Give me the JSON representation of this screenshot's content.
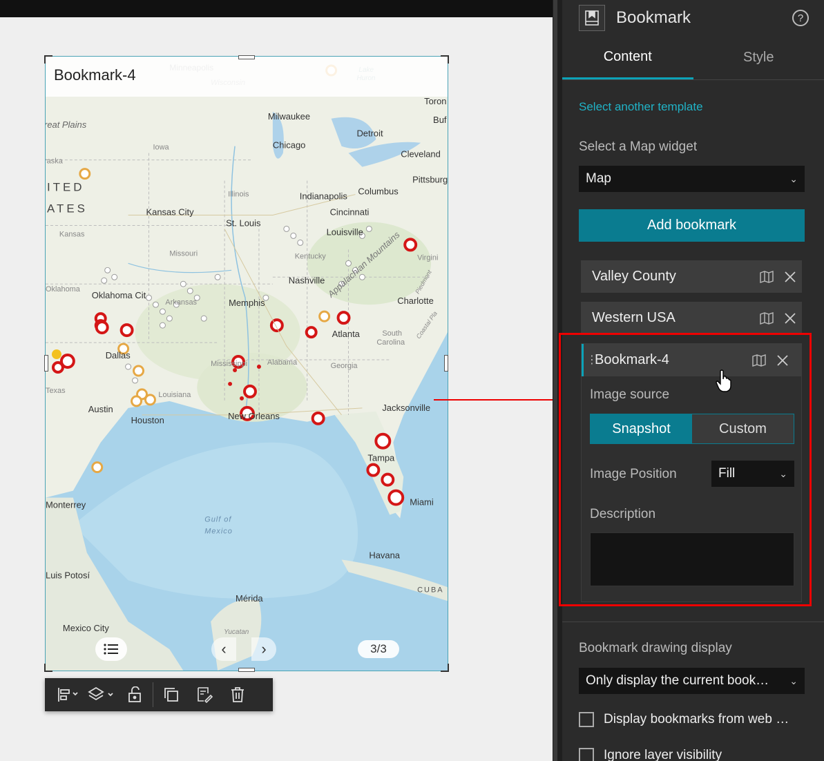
{
  "widget": {
    "title": "Bookmark-4",
    "page_count": "3/3",
    "map_labels": {
      "cities": [
        {
          "name": "Minneapolis"
        },
        {
          "name": "Wisconsin"
        },
        {
          "name": "Lake Huron"
        },
        {
          "name": "Toron"
        },
        {
          "name": "Milwaukee"
        },
        {
          "name": "Buf"
        },
        {
          "name": "reat Plains"
        },
        {
          "name": "Detroit"
        },
        {
          "name": "Iowa"
        },
        {
          "name": "Chicago"
        },
        {
          "name": "Cleveland"
        },
        {
          "name": "raska"
        },
        {
          "name": "Pittsburg"
        },
        {
          "name": "ITED"
        },
        {
          "name": "Columbus"
        },
        {
          "name": "Illinois"
        },
        {
          "name": "Indianapolis"
        },
        {
          "name": "ATES"
        },
        {
          "name": "Kansas City"
        },
        {
          "name": "Cincinnati"
        },
        {
          "name": "St. Louis"
        },
        {
          "name": "Kansas"
        },
        {
          "name": "Louisville"
        },
        {
          "name": "Missouri"
        },
        {
          "name": "Kentucky"
        },
        {
          "name": "Appalachian Mountains"
        },
        {
          "name": "Virgini"
        },
        {
          "name": "Nashville"
        },
        {
          "name": "Oklahoma"
        },
        {
          "name": "Oklahoma City"
        },
        {
          "name": "Arkansas"
        },
        {
          "name": "Piedmont"
        },
        {
          "name": "Memphis"
        },
        {
          "name": "Charlotte"
        },
        {
          "name": "Coastal Pla"
        },
        {
          "name": "Atlanta"
        },
        {
          "name": "South Carolina"
        },
        {
          "name": "Dallas"
        },
        {
          "name": "Mississippi"
        },
        {
          "name": "Alabama"
        },
        {
          "name": "Georgia"
        },
        {
          "name": "Texas"
        },
        {
          "name": "Louisiana"
        },
        {
          "name": "Austin"
        },
        {
          "name": "Houston"
        },
        {
          "name": "New Orleans"
        },
        {
          "name": "Jacksonville"
        },
        {
          "name": "Tampa"
        },
        {
          "name": "Monterrey"
        },
        {
          "name": "Miami"
        },
        {
          "name": "Gulf of"
        },
        {
          "name": "Mexico"
        },
        {
          "name": "Havana"
        },
        {
          "name": "Luis Potosí"
        },
        {
          "name": "CUBA"
        },
        {
          "name": "Mérida"
        },
        {
          "name": "Mexico City"
        },
        {
          "name": "Yucatan"
        }
      ]
    }
  },
  "toolbar": {
    "icons": [
      "align-icon",
      "layers-icon",
      "lock-icon",
      "duplicate-icon",
      "edit-icon",
      "delete-icon"
    ]
  },
  "panel": {
    "title": "Bookmark",
    "help": "?",
    "tabs": [
      {
        "label": "Content",
        "active": true
      },
      {
        "label": "Style",
        "active": false
      }
    ],
    "select_template_link": "Select another template",
    "map_widget_label": "Select a Map widget",
    "map_widget_value": "Map",
    "add_bookmark": "Add bookmark",
    "bookmarks": [
      {
        "name": "Valley County"
      },
      {
        "name": "Western USA"
      },
      {
        "name": "Bookmark-4"
      }
    ],
    "expanded": {
      "image_source_label": "Image source",
      "image_source_options": [
        "Snapshot",
        "Custom"
      ],
      "image_source_selected": "Snapshot",
      "image_position_label": "Image Position",
      "image_position_value": "Fill",
      "description_label": "Description",
      "description_value": ""
    },
    "drawing_display_label": "Bookmark drawing display",
    "drawing_display_value": "Only display the current book…",
    "checkboxes": [
      {
        "label": "Display bookmarks from web …",
        "checked": false
      },
      {
        "label": "Ignore layer visibility",
        "checked": false
      }
    ]
  },
  "colors": {
    "accent": "#0a7c90",
    "link": "#20b3c7",
    "annotation": "#e00000",
    "panel_bg": "#2b2b2b"
  }
}
